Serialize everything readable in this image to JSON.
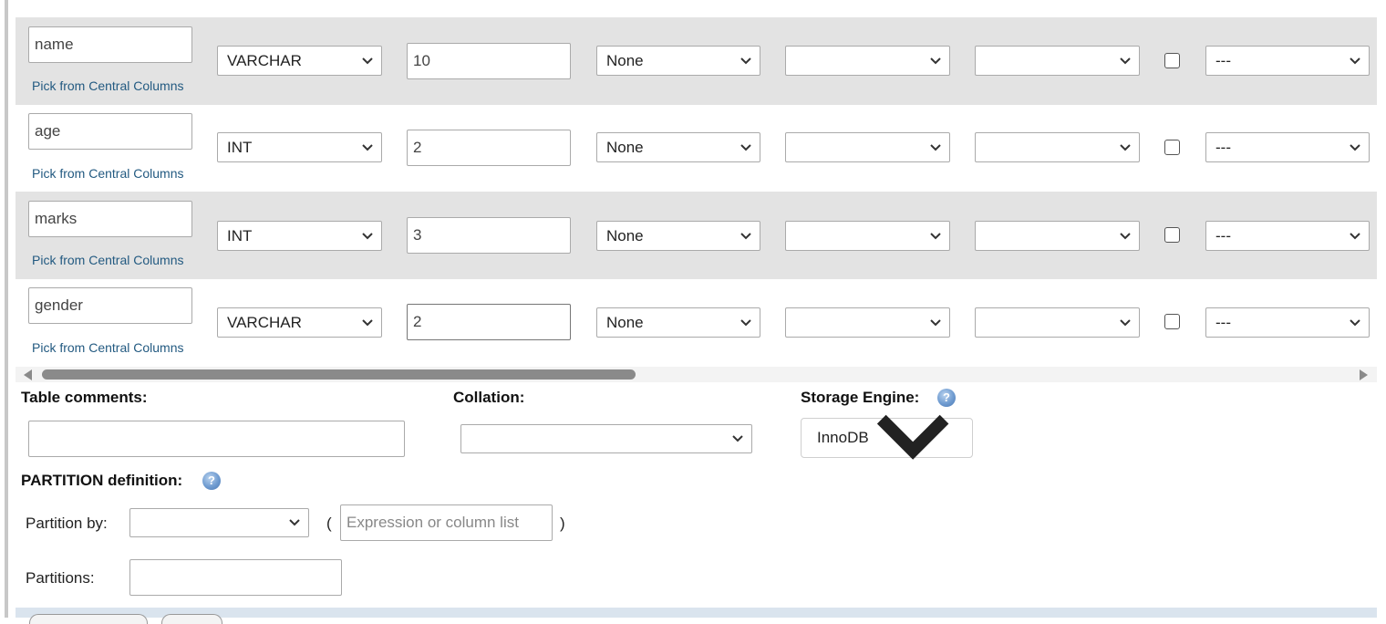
{
  "columns": [
    {
      "name": "name",
      "type": "VARCHAR",
      "length": "10",
      "default": "None",
      "collation": "",
      "attributes": "",
      "null_checked": false,
      "index": "---",
      "pick_link": "Pick from Central Columns"
    },
    {
      "name": "age",
      "type": "INT",
      "length": "2",
      "default": "None",
      "collation": "",
      "attributes": "",
      "null_checked": false,
      "index": "---",
      "pick_link": "Pick from Central Columns"
    },
    {
      "name": "marks",
      "type": "INT",
      "length": "3",
      "default": "None",
      "collation": "",
      "attributes": "",
      "null_checked": false,
      "index": "---",
      "pick_link": "Pick from Central Columns"
    },
    {
      "name": "gender",
      "type": "VARCHAR",
      "length": "2",
      "default": "None",
      "collation": "",
      "attributes": "",
      "null_checked": false,
      "index": "---",
      "pick_link": "Pick from Central Columns"
    }
  ],
  "table_options": {
    "comments_label": "Table comments:",
    "comments_value": "",
    "collation_label": "Collation:",
    "collation_value": "",
    "engine_label": "Storage Engine:",
    "engine_value": "InnoDB",
    "help_icon": "help-icon"
  },
  "partition": {
    "heading": "PARTITION definition:",
    "by_label": "Partition by:",
    "by_value": "",
    "open_paren": "(",
    "close_paren": ")",
    "expression_placeholder": "Expression or column list",
    "partitions_label": "Partitions:",
    "partitions_value": ""
  },
  "colors": {
    "row_shade": "#e3e3e3",
    "link": "#235a81",
    "footer": "#dae4ee"
  }
}
